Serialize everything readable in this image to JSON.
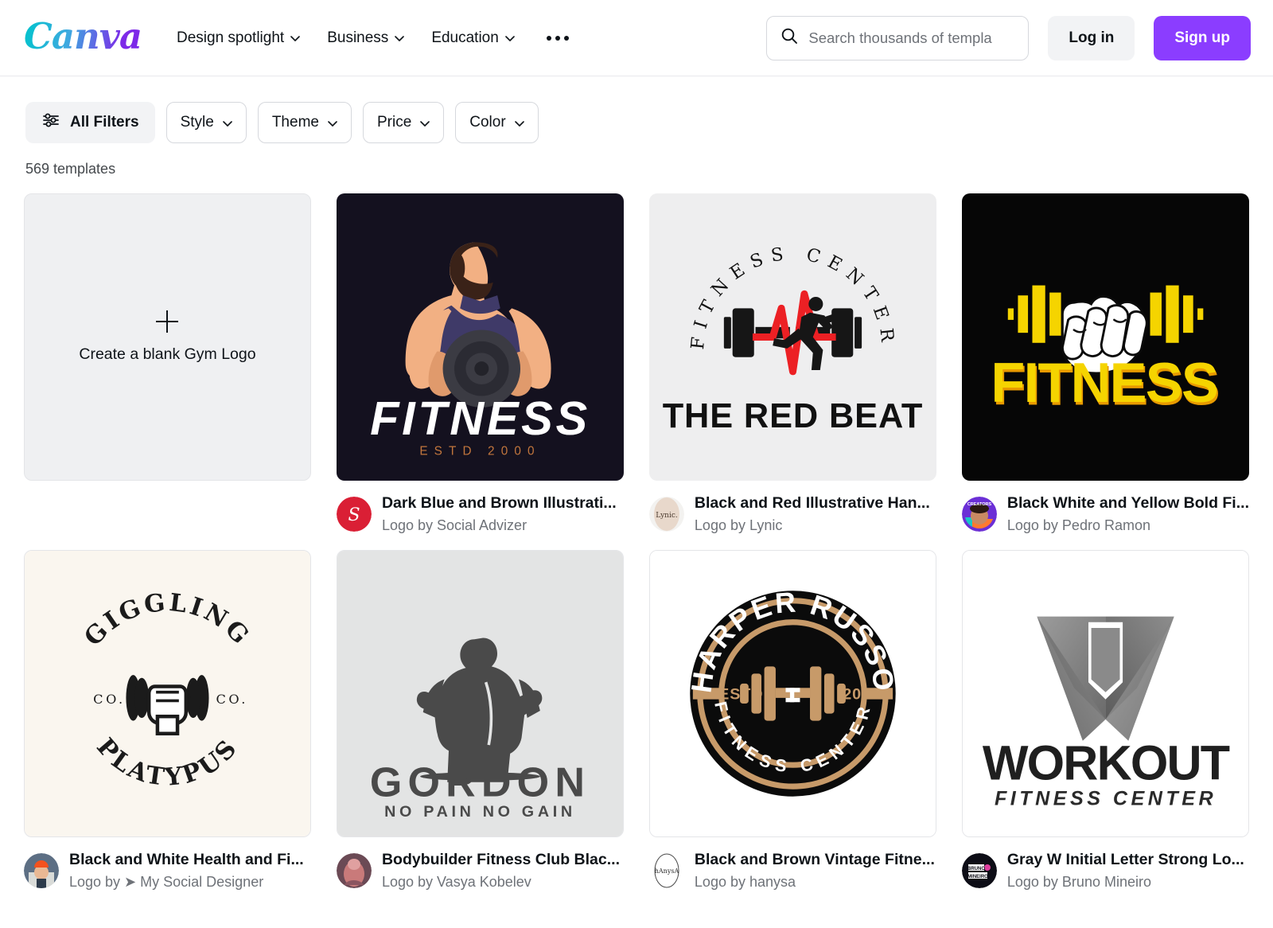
{
  "header": {
    "brand": "Canva",
    "nav": [
      {
        "label": "Design spotlight",
        "has_chevron": true
      },
      {
        "label": "Business",
        "has_chevron": true
      },
      {
        "label": "Education",
        "has_chevron": true
      }
    ],
    "more_icon": "ellipsis-icon",
    "search": {
      "icon": "search-icon",
      "placeholder": "Search thousands of templa",
      "value": ""
    },
    "login_label": "Log in",
    "signup_label": "Sign up",
    "signup_color": "#8b3dff"
  },
  "filters": {
    "all_filters_label": "All Filters",
    "all_filters_icon": "sliders-icon",
    "pills": [
      {
        "label": "Style"
      },
      {
        "label": "Theme"
      },
      {
        "label": "Price"
      },
      {
        "label": "Color"
      }
    ],
    "result_count": "569 templates"
  },
  "grid": {
    "blank_card": {
      "label": "Create a blank Gym Logo",
      "icon": "plus-icon"
    },
    "items": [
      {
        "title": "Dark Blue and Brown Illustrati...",
        "author": "Logo by Social Advizer",
        "art": "fitness-bodybuilder",
        "bg": "#14111f",
        "logo_text": "FITNESS",
        "logo_sub": "ESTD 2000",
        "avatar": "social-advizer-avatar"
      },
      {
        "title": "Black and Red Illustrative Han...",
        "author": "Logo by Lynic",
        "art": "red-beat-badge",
        "bg": "#eeeeef",
        "logo_arc": "FITNESS CENTER",
        "logo_text": "THE RED BEAT",
        "avatar": "lynic-avatar"
      },
      {
        "title": "Black White and Yellow Bold Fi...",
        "author": "Logo by Pedro Ramon",
        "art": "yellow-fist-fitness",
        "bg": "#060606",
        "logo_text": "FITNESS",
        "avatar": "pedro-ramon-avatar"
      },
      {
        "title": "Black and White Health and Fi...",
        "author": "Logo by ➤ My Social Designer",
        "art": "giggling-platypus-circle",
        "bg": "#faf6ef",
        "logo_arc_top": "GIGGLING",
        "logo_arc_bottom": "PLATYPUS",
        "logo_left": "CO.",
        "logo_right": "CO.",
        "avatar": "my-social-designer-avatar"
      },
      {
        "title": "Bodybuilder Fitness Club Blac...",
        "author": "Logo by Vasya Kobelev",
        "art": "gordon-bodybuilder",
        "bg": "#e3e4e4",
        "logo_text": "GORDON",
        "logo_sub": "NO PAIN NO GAIN",
        "avatar": "vasya-kobelev-avatar"
      },
      {
        "title": "Black and Brown Vintage Fitne...",
        "author": "Logo by hanysa",
        "art": "harper-russo-badge",
        "bg": "#ffffff",
        "logo_arc_top": "HARPER RUSSO",
        "logo_arc_bottom": "FITNESS CENTER",
        "logo_left": "ESTD",
        "logo_right": "2023",
        "avatar": "hanysa-avatar"
      },
      {
        "title": "Gray W Initial Letter Strong Lo...",
        "author": "Logo by Bruno Mineiro",
        "art": "workout-w-mark",
        "bg": "#ffffff",
        "logo_text": "WORKOUT",
        "logo_sub": "FITNESS CENTER",
        "avatar": "bruno-mineiro-avatar"
      }
    ]
  }
}
